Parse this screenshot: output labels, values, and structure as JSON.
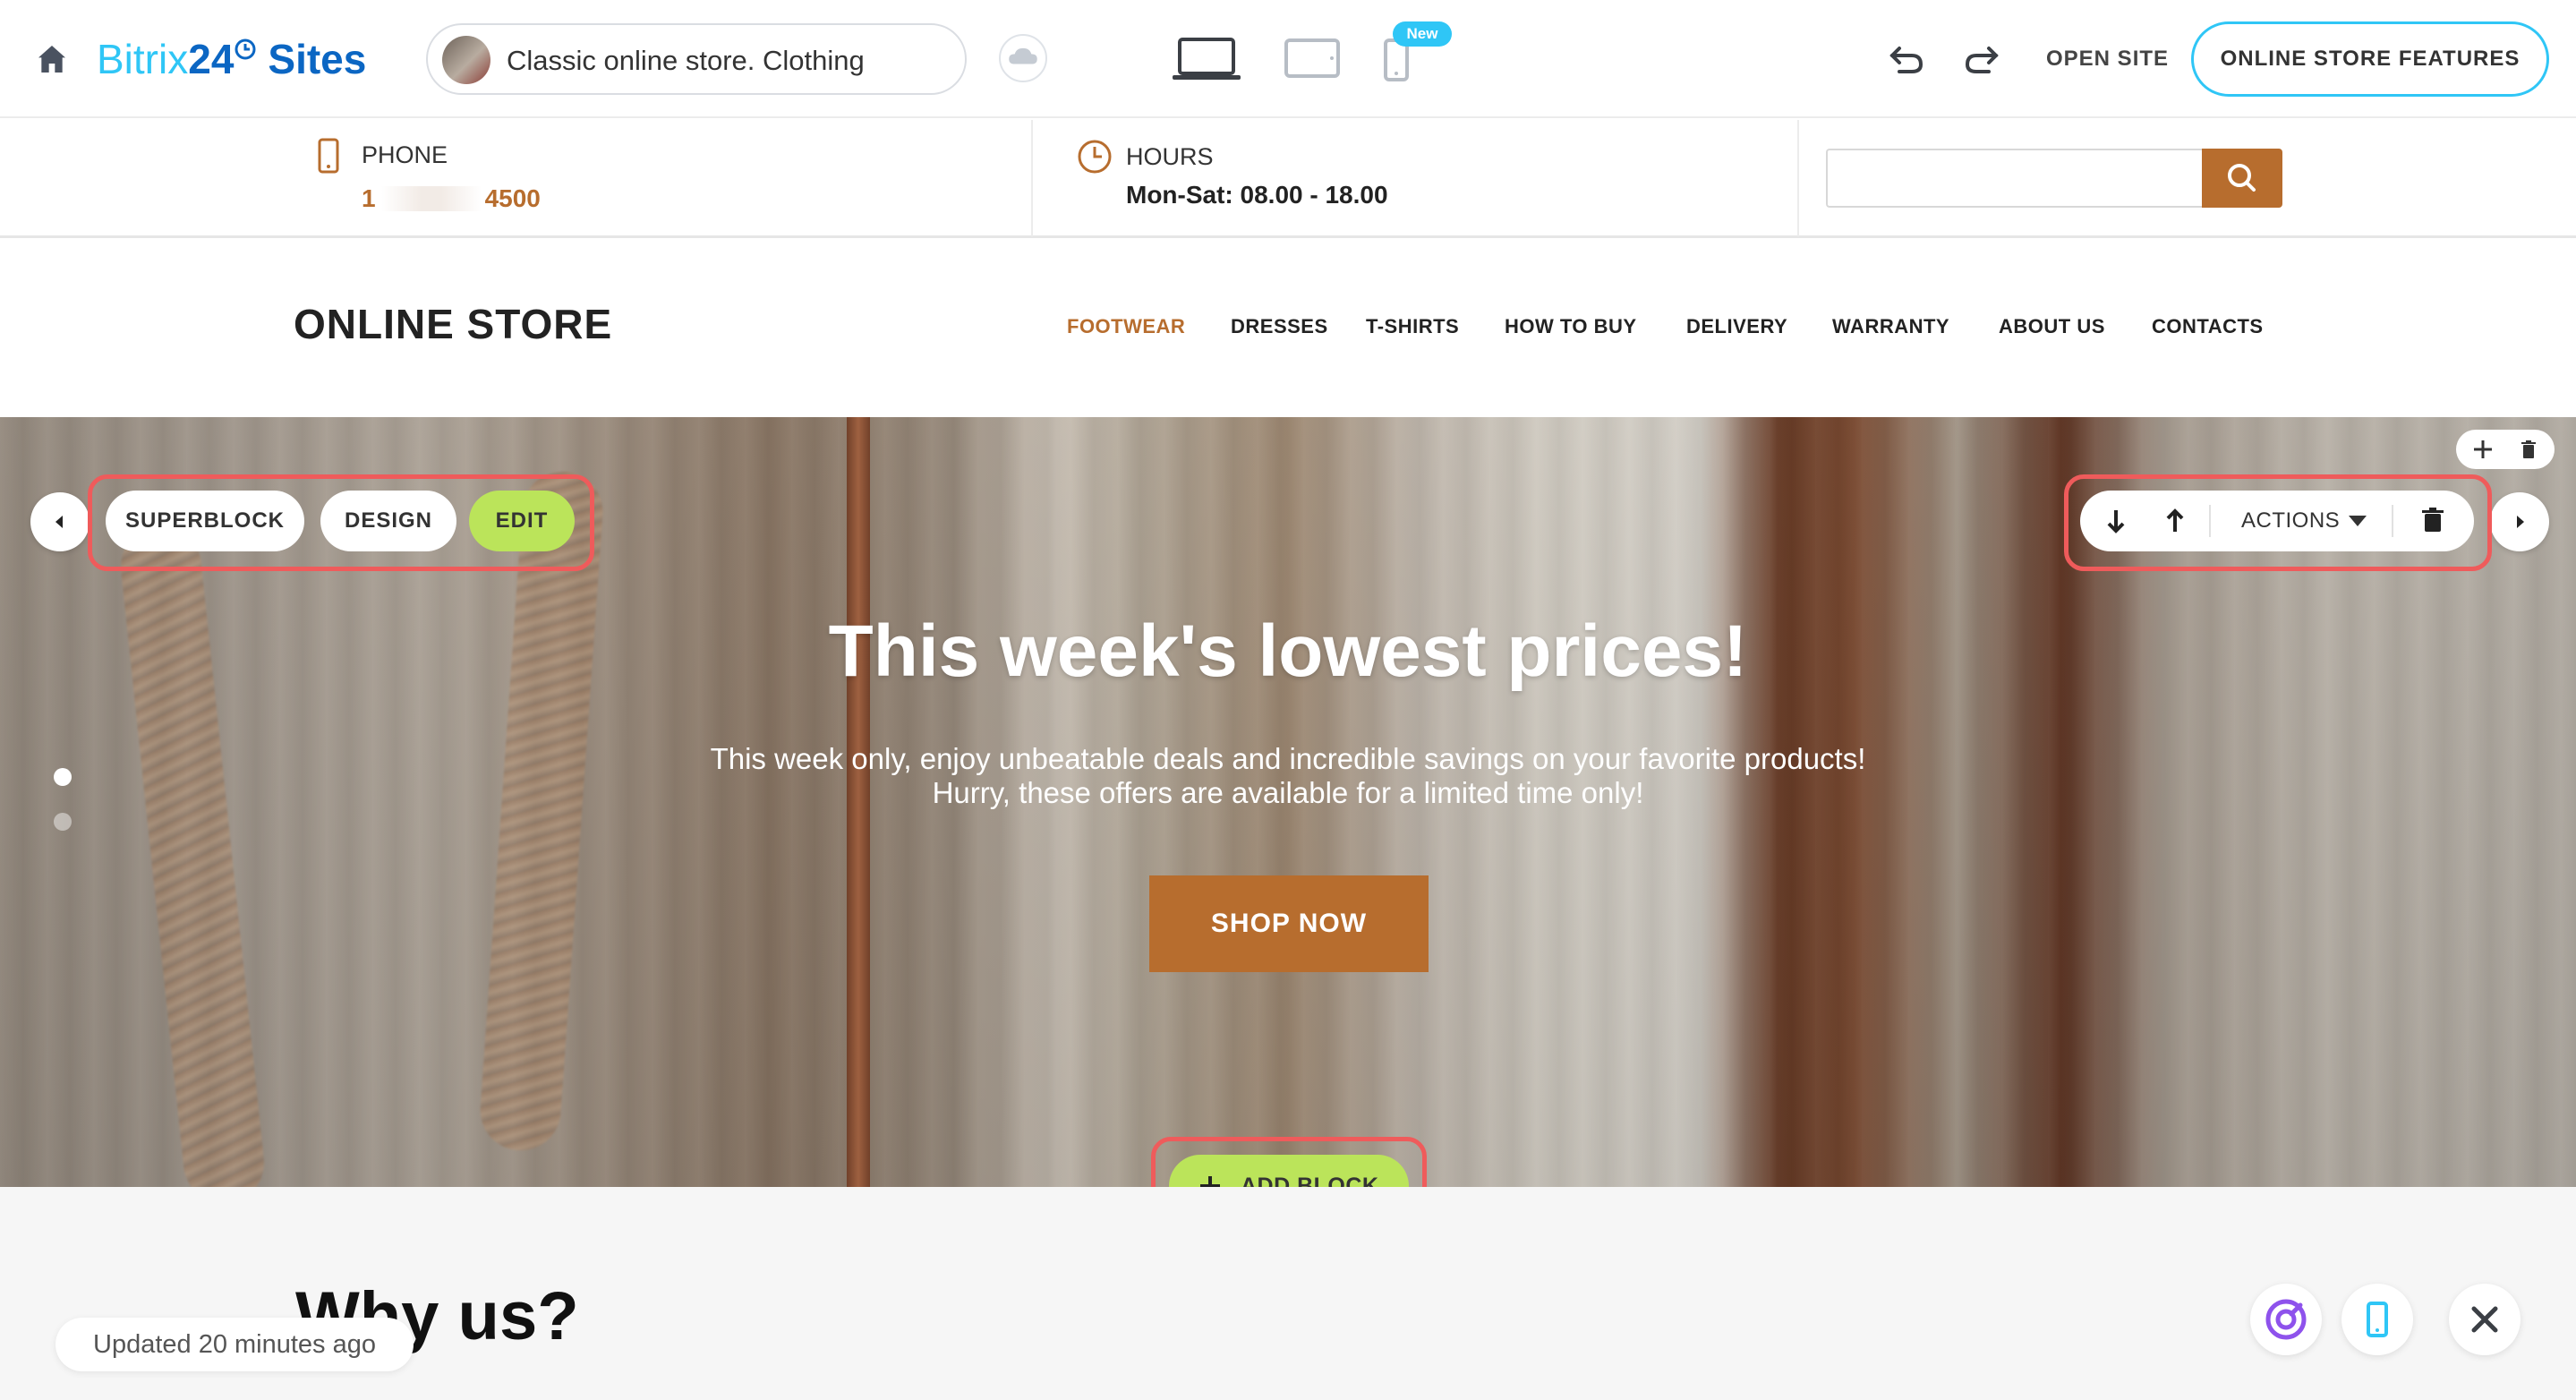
{
  "editor": {
    "brand": {
      "part1": "Bitrix",
      "part2": "24",
      "part3": "Sites"
    },
    "site_name": "Classic online store. Clothing",
    "new_badge": "New",
    "open_site": "OPEN SITE",
    "features_button": "ONLINE STORE FEATURES",
    "icons": [
      "home-icon",
      "cloud-icon",
      "desktop-icon",
      "tablet-icon",
      "mobile-icon",
      "undo-icon",
      "redo-icon"
    ]
  },
  "store_info": {
    "phone_label": "PHONE",
    "phone_start": "1",
    "phone_end": "4500",
    "hours_label": "HOURS",
    "hours_value": "Mon-Sat: 08.00 - 18.00",
    "search_placeholder": ""
  },
  "store": {
    "logo": "ONLINE STORE",
    "nav": [
      {
        "label": "FOOTWEAR",
        "active": true
      },
      {
        "label": "DRESSES"
      },
      {
        "label": "T-SHIRTS"
      },
      {
        "label": "HOW TO BUY"
      },
      {
        "label": "DELIVERY"
      },
      {
        "label": "WARRANTY"
      },
      {
        "label": "ABOUT US"
      },
      {
        "label": "CONTACTS"
      }
    ]
  },
  "hero": {
    "title": "This week's lowest prices!",
    "subtitle_line1": "This week only, enjoy unbeatable deals and incredible savings on your favorite products!",
    "subtitle_line2": "Hurry, these offers are available for a limited time only!",
    "cta": "SHOP NOW",
    "slide_count": 2,
    "active_slide": 1
  },
  "block_controls": {
    "superblock": "SUPERBLOCK",
    "design": "DESIGN",
    "edit": "EDIT",
    "actions": "ACTIONS",
    "add_block": "ADD BLOCK"
  },
  "lower": {
    "heading": "Why us?",
    "updated": "Updated 20 minutes ago"
  },
  "colors": {
    "accent": "#b76d2e",
    "brand_blue": "#0b66c3",
    "brand_light_blue": "#2fc6f6",
    "edit_green": "#bbe45a",
    "highlight_red": "#ef5b5b"
  }
}
